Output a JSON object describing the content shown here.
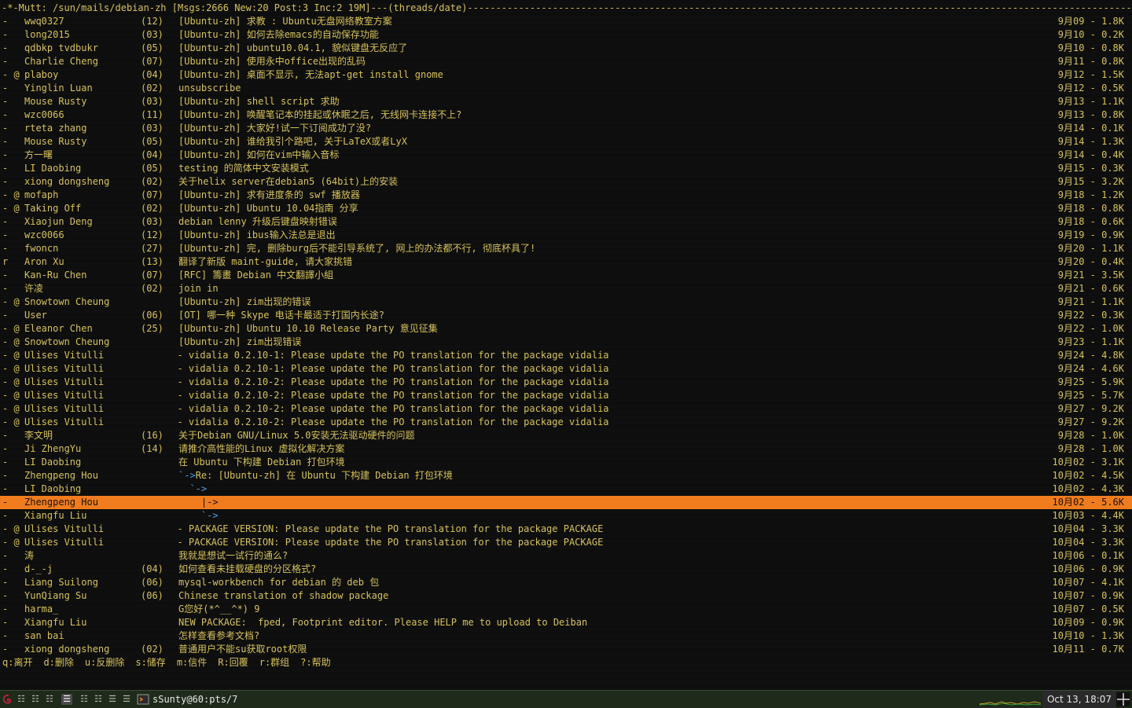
{
  "status_line": "-*-Mutt: /sun/mails/debian-zh [Msgs:2666 New:20 Post:3 Inc:2 19M]---(threads/date)--------------------------------------------------------------------------------------------------------------------------(end)---",
  "messages": [
    {
      "flag": "-",
      "from": "wwq0327",
      "count": "(12)",
      "subject": "[Ubuntu-zh] 求教 : Ubuntu无盘网络教室方案",
      "tree": "",
      "date": "9月09 - 1.8K"
    },
    {
      "flag": "-",
      "from": "long2015",
      "count": "(03)",
      "subject": "[Ubuntu-zh] 如何去除emacs的自动保存功能",
      "tree": "",
      "date": "9月10 - 0.2K"
    },
    {
      "flag": "-",
      "from": "qdbkp tvdbukr",
      "count": "(05)",
      "subject": "[Ubuntu-zh] ubuntu10.04.1, 貌似键盘无反应了",
      "tree": "",
      "date": "9月10 - 0.8K"
    },
    {
      "flag": "-",
      "from": "Charlie Cheng",
      "count": "(07)",
      "subject": "[Ubuntu-zh] 使用永中office出现的乱码",
      "tree": "",
      "date": "9月11 - 0.8K"
    },
    {
      "flag": "- @",
      "from": "plaboy",
      "count": "(04)",
      "subject": "[Ubuntu-zh] 桌面不显示, 无法apt-get install gnome",
      "tree": "",
      "date": "9月12 - 1.5K"
    },
    {
      "flag": "-",
      "from": "Yinglin Luan",
      "count": "(02)",
      "subject": "unsubscribe",
      "tree": "",
      "date": "9月12 - 0.5K"
    },
    {
      "flag": "-",
      "from": "Mouse Rusty",
      "count": "(03)",
      "subject": "[Ubuntu-zh] shell script 求助",
      "tree": "",
      "date": "9月13 - 1.1K"
    },
    {
      "flag": "-",
      "from": "wzc0066",
      "count": "(11)",
      "subject": "[Ubuntu-zh] 唤醒笔记本的挂起或休眠之后, 无线网卡连接不上?",
      "tree": "",
      "date": "9月13 - 0.8K"
    },
    {
      "flag": "-",
      "from": "rteta zhang",
      "count": "(03)",
      "subject": "[Ubuntu-zh] 大家好!试一下订阅成功了没?",
      "tree": "",
      "date": "9月14 - 0.1K"
    },
    {
      "flag": "-",
      "from": "Mouse Rusty",
      "count": "(05)",
      "subject": "[Ubuntu-zh] 谁给我引个路吧, 关于LaTeX或者LyX",
      "tree": "",
      "date": "9月14 - 1.3K"
    },
    {
      "flag": "-",
      "from": "方一曙",
      "count": "(04)",
      "subject": "[Ubuntu-zh] 如何在vim中输入音标",
      "tree": "",
      "date": "9月14 - 0.4K"
    },
    {
      "flag": "-",
      "from": "LI Daobing",
      "count": "(05)",
      "subject": "testing 的简体中文安装模式",
      "tree": "",
      "date": "9月15 - 0.3K"
    },
    {
      "flag": "-",
      "from": "xiong dongsheng",
      "count": "(02)",
      "subject": "关于helix server在debian5 (64bit)上的安装",
      "tree": "",
      "date": "9月15 - 3.2K"
    },
    {
      "flag": "- @",
      "from": "mofaph",
      "count": "(07)",
      "subject": "[Ubuntu-zh] 求有进度条的 swf 播放器",
      "tree": "",
      "date": "9月18 - 1.2K"
    },
    {
      "flag": "- @",
      "from": "Taking Off",
      "count": "(02)",
      "subject": "[Ubuntu-zh] Ubuntu 10.04指南 分享",
      "tree": "",
      "date": "9月18 - 0.8K"
    },
    {
      "flag": "-",
      "from": "Xiaojun Deng",
      "count": "(03)",
      "subject": "debian lenny 升级后键盘映射错误",
      "tree": "",
      "date": "9月18 - 0.6K"
    },
    {
      "flag": "-",
      "from": "wzc0066",
      "count": "(12)",
      "subject": "[Ubuntu-zh] ibus输入法总是退出",
      "tree": "",
      "date": "9月19 - 0.9K"
    },
    {
      "flag": "-",
      "from": "fwoncn",
      "count": "(27)",
      "subject": "[Ubuntu-zh] 完, 删除burg后不能引导系统了, 网上的办法都不行, 彻底杯具了!",
      "tree": "",
      "date": "9月20 - 1.1K"
    },
    {
      "flag": "r",
      "from": "Aron Xu",
      "count": "(13)",
      "subject": "翻译了新版 maint-guide, 请大家挑错",
      "tree": "",
      "date": "9月20 - 0.4K"
    },
    {
      "flag": "-",
      "from": "Kan-Ru Chen",
      "count": "(07)",
      "subject": "[RFC] 籌畫 Debian 中文翻譯小組",
      "tree": "",
      "date": "9月21 - 3.5K"
    },
    {
      "flag": "-",
      "from": "许凌",
      "count": "(02)",
      "subject": "join in",
      "tree": "",
      "date": "9月21 - 0.6K"
    },
    {
      "flag": "- @",
      "from": "Snowtown Cheung",
      "count": "",
      "subject": "[Ubuntu-zh] zim出现的错误",
      "tree": "",
      "date": "9月21 - 1.1K"
    },
    {
      "flag": "-",
      "from": "User",
      "count": "(06)",
      "subject": "[OT] 哪一种 Skype 电话卡最适于打国内长途?",
      "tree": "",
      "date": "9月22 - 0.3K"
    },
    {
      "flag": "- @",
      "from": "Eleanor Chen",
      "count": "(25)",
      "subject": "[Ubuntu-zh] Ubuntu 10.10 Release Party 意见征集",
      "tree": "",
      "date": "9月22 - 1.0K"
    },
    {
      "flag": "- @",
      "from": "Snowtown Cheung",
      "count": "",
      "subject": "[Ubuntu-zh] zim出现错误",
      "tree": "",
      "date": "9月23 - 1.1K"
    },
    {
      "flag": "- @",
      "from": "Ulises Vitulli",
      "count": "",
      "subject": "  - vidalia 0.2.10-1: Please update the PO translation for the package vidalia",
      "tree": "",
      "date": "9月24 - 4.8K",
      "shift": true
    },
    {
      "flag": "- @",
      "from": "Ulises Vitulli",
      "count": "",
      "subject": "  - vidalia 0.2.10-1: Please update the PO translation for the package vidalia",
      "tree": "",
      "date": "9月24 - 4.6K",
      "shift": true
    },
    {
      "flag": "- @",
      "from": "Ulises Vitulli",
      "count": "",
      "subject": "  - vidalia 0.2.10-2: Please update the PO translation for the package vidalia",
      "tree": "",
      "date": "9月25 - 5.9K",
      "shift": true
    },
    {
      "flag": "- @",
      "from": "Ulises Vitulli",
      "count": "",
      "subject": "  - vidalia 0.2.10-2: Please update the PO translation for the package vidalia",
      "tree": "",
      "date": "9月25 - 5.7K",
      "shift": true
    },
    {
      "flag": "- @",
      "from": "Ulises Vitulli",
      "count": "",
      "subject": "  - vidalia 0.2.10-2: Please update the PO translation for the package vidalia",
      "tree": "",
      "date": "9月27 - 9.2K",
      "shift": true
    },
    {
      "flag": "- @",
      "from": "Ulises Vitulli",
      "count": "",
      "subject": "  - vidalia 0.2.10-2: Please update the PO translation for the package vidalia",
      "tree": "",
      "date": "9月27 - 9.2K",
      "shift": true
    },
    {
      "flag": "-",
      "from": "李文明",
      "count": "(16)",
      "subject": "关于Debian GNU/Linux 5.0安装无法驱动硬件的问题",
      "tree": "",
      "date": "9月28 - 1.0K"
    },
    {
      "flag": "-",
      "from": "Ji ZhengYu",
      "count": "(14)",
      "subject": "请推介高性能的Linux 虚拟化解决方案",
      "tree": "",
      "date": "9月28 - 1.0K"
    },
    {
      "flag": "-",
      "from": "LI Daobing",
      "count": "",
      "subject": "在 Ubuntu 下构建 Debian 打包环境",
      "tree": "",
      "date": "10月02 - 3.1K"
    },
    {
      "flag": "-",
      "from": "Zhengpeng Hou",
      "count": "",
      "subject": "Re: [Ubuntu-zh] 在 Ubuntu 下构建 Debian 打包环境",
      "tree": "`->",
      "date": "10月02 - 4.5K"
    },
    {
      "flag": "-",
      "from": "LI Daobing",
      "count": "",
      "subject": "",
      "tree": "  `->",
      "date": "10月02 - 4.3K"
    },
    {
      "flag": "-",
      "from": "Zhengpeng Hou",
      "count": "",
      "subject": "",
      "tree": "    |->",
      "date": "10月02 - 5.6K",
      "selected": true
    },
    {
      "flag": "-",
      "from": "Xiangfu Liu",
      "count": "",
      "subject": "",
      "tree": "    `->",
      "date": "10月03 - 4.4K"
    },
    {
      "flag": "- @",
      "from": "Ulises Vitulli",
      "count": "",
      "subject": "  - PACKAGE VERSION: Please update the PO translation for the package PACKAGE",
      "tree": "",
      "date": "10月04 - 3.3K",
      "shift": true
    },
    {
      "flag": "- @",
      "from": "Ulises Vitulli",
      "count": "",
      "subject": "  - PACKAGE VERSION: Please update the PO translation for the package PACKAGE",
      "tree": "",
      "date": "10月04 - 3.3K",
      "shift": true
    },
    {
      "flag": "-",
      "from": "涛",
      "count": "",
      "subject": "我就是想试一试行的通么?",
      "tree": "",
      "date": "10月06 - 0.1K"
    },
    {
      "flag": "-",
      "from": "d-_-j",
      "count": "(04)",
      "subject": "如何查看未挂载硬盘的分区格式?",
      "tree": "",
      "date": "10月06 - 0.9K"
    },
    {
      "flag": "-",
      "from": "Liang Suilong",
      "count": "(06)",
      "subject": "mysql-workbench for debian 的 deb 包",
      "tree": "",
      "date": "10月07 - 4.1K"
    },
    {
      "flag": "-",
      "from": "YunQiang Su",
      "count": "(06)",
      "subject": "Chinese translation of shadow package",
      "tree": "",
      "date": "10月07 - 0.9K"
    },
    {
      "flag": "-",
      "from": "harma_",
      "count": "",
      "subject": "G您好(*^__^*) 9",
      "tree": "",
      "date": "10月07 - 0.5K"
    },
    {
      "flag": "-",
      "from": "Xiangfu Liu",
      "count": "",
      "subject": "NEW PACKAGE:  fped, Footprint editor. Please HELP me to upload to Deiban",
      "tree": "",
      "date": "10月09 - 0.9K"
    },
    {
      "flag": "-",
      "from": "san bai",
      "count": "",
      "subject": "怎样查看参考文档?",
      "tree": "",
      "date": "10月10 - 1.3K"
    },
    {
      "flag": "-",
      "from": "xiong dongsheng",
      "count": "(02)",
      "subject": "普通用户不能su获取root权限",
      "tree": "",
      "date": "10月11 - 0.7K"
    }
  ],
  "help_bar": [
    "q:离开",
    "d:删除",
    "u:反删除",
    "s:储存",
    "m:信件",
    "R:回覆",
    "r:群组",
    "?:帮助"
  ],
  "taskbar": {
    "window_title": "sSunty@60:pts/7",
    "clock": "Oct 13, 18:07",
    "logo_icon": "debian-swirl-icon",
    "app_icon": "terminal-icon"
  },
  "colors": {
    "text": "#d6c25a",
    "background": "#0d0d0d",
    "selected_bg": "#f07c1e",
    "tree_arrow": "#4aa3e8"
  }
}
